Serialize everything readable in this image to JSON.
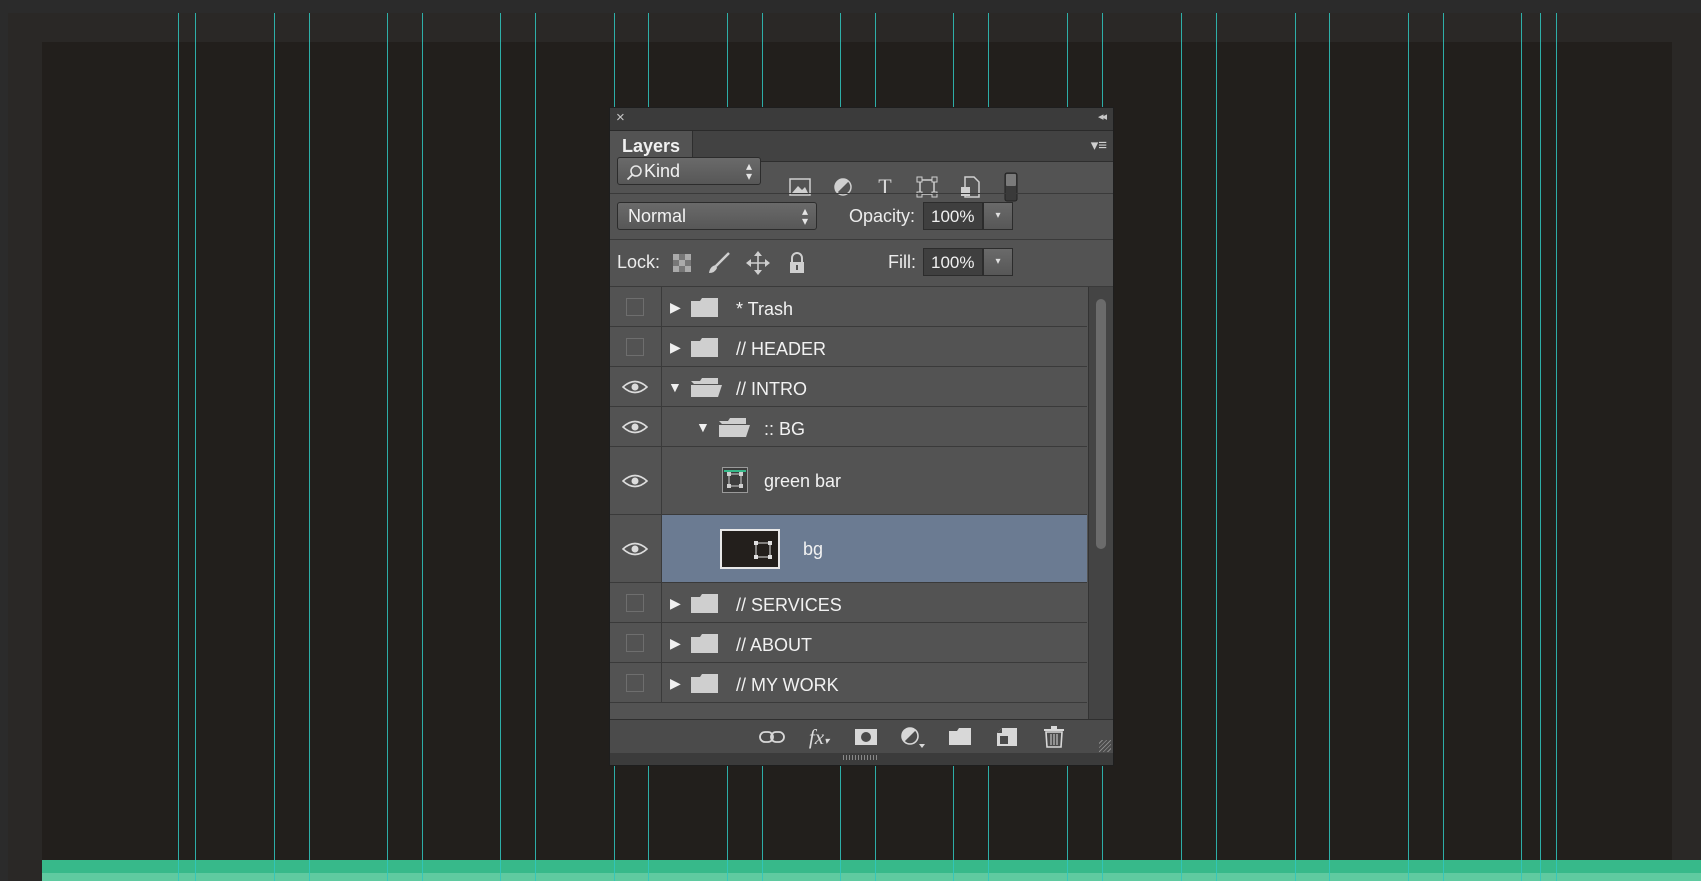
{
  "colors": {
    "canvas": "#221f1c",
    "guide": "#2fc7c0",
    "green_bar": "#37b98a",
    "panel": "#535353",
    "selected_row": "#6b7b92"
  },
  "panel": {
    "close_glyph": "×",
    "collapse_glyph": "◂◂",
    "tab_label": "Layers",
    "menu_glyph": "▾≡",
    "filter": {
      "kind_icon": "search-icon",
      "kind_label": "Kind",
      "icons": [
        "pixel-layer-filter-icon",
        "adjustment-layer-filter-icon",
        "type-layer-filter-icon",
        "shape-layer-filter-icon",
        "smart-object-filter-icon",
        "filter-toggle-icon"
      ]
    },
    "blend": {
      "mode": "Normal",
      "opacity_label": "Opacity:",
      "opacity_value": "100%"
    },
    "lock": {
      "label": "Lock:",
      "fill_label": "Fill:",
      "fill_value": "100%"
    },
    "layers": [
      {
        "name": "* Trash",
        "type": "group",
        "expanded": false,
        "visible": false
      },
      {
        "name": "// HEADER",
        "type": "group",
        "expanded": false,
        "visible": false
      },
      {
        "name": "// INTRO",
        "type": "group",
        "expanded": true,
        "visible": true
      },
      {
        "name": ":: BG",
        "type": "group",
        "expanded": true,
        "visible": true
      },
      {
        "name": "green bar",
        "type": "shape",
        "visible": true
      },
      {
        "name": "bg",
        "type": "shape",
        "visible": true,
        "selected": true
      },
      {
        "name": "// SERVICES",
        "type": "group",
        "expanded": false,
        "visible": false
      },
      {
        "name": "// ABOUT",
        "type": "group",
        "expanded": false,
        "visible": false
      },
      {
        "name": "// MY WORK",
        "type": "group",
        "expanded": false,
        "visible": false
      }
    ],
    "footer_icons": [
      "link-layers-icon",
      "fx-icon",
      "add-mask-icon",
      "adjustment-layer-icon",
      "new-group-icon",
      "new-layer-icon",
      "delete-layer-icon"
    ]
  }
}
